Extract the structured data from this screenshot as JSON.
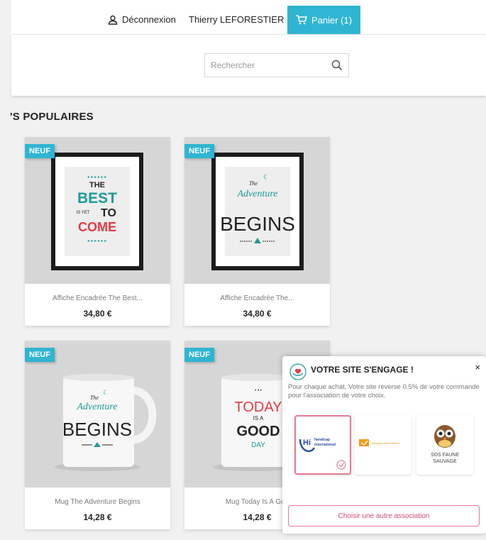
{
  "header": {
    "logout_label": "Déconnexion",
    "username": "Thierry LEFORESTIER",
    "cart_label": "Panier (1)"
  },
  "search": {
    "placeholder": "Rechercher"
  },
  "section_title": "'S POPULAIRES",
  "products": [
    {
      "badge": "NEUF",
      "name": "Affiche Encadrée The Best...",
      "price": "34,80 €"
    },
    {
      "badge": "NEUF",
      "name": "Affiche Encadrée The...",
      "price": "34,80 €"
    },
    {
      "badge": "NEUF",
      "name": "Mug The Adventure Begins",
      "price": "14,28 €"
    },
    {
      "badge": "NEUF",
      "name": "Mug Today Is A Goo",
      "price": "14,28 €"
    }
  ],
  "artwork": {
    "best": {
      "l1": "THE",
      "l2": "BEST",
      "l3": "IS YET",
      "l4": "TO",
      "l5": "COME"
    },
    "adventure": {
      "l1": "The",
      "l2": "Adventure",
      "l3": "BEGINS"
    },
    "today": {
      "l1": "TODAY",
      "l2": "IS A",
      "l3": "GOOD",
      "l4": "DAY"
    }
  },
  "popup": {
    "title": "VOTRE SITE S'ENGAGE !",
    "close": "×",
    "text": "Pour chaque achat, Votre site reverse 0.5% de votre commande pour l'association de votre choix.",
    "associations": [
      {
        "name": "handicap international",
        "short": "Hi"
      },
      {
        "name": "Banques Alimentaires",
        "short": ""
      },
      {
        "name1": "SOS FAUNE",
        "name2": "SAUVAGE"
      }
    ],
    "button": "Choisir une autre association"
  },
  "colors": {
    "accent": "#2fb5d2",
    "pink": "#e57a94",
    "red": "#e63946",
    "teal": "#1e9a98"
  }
}
